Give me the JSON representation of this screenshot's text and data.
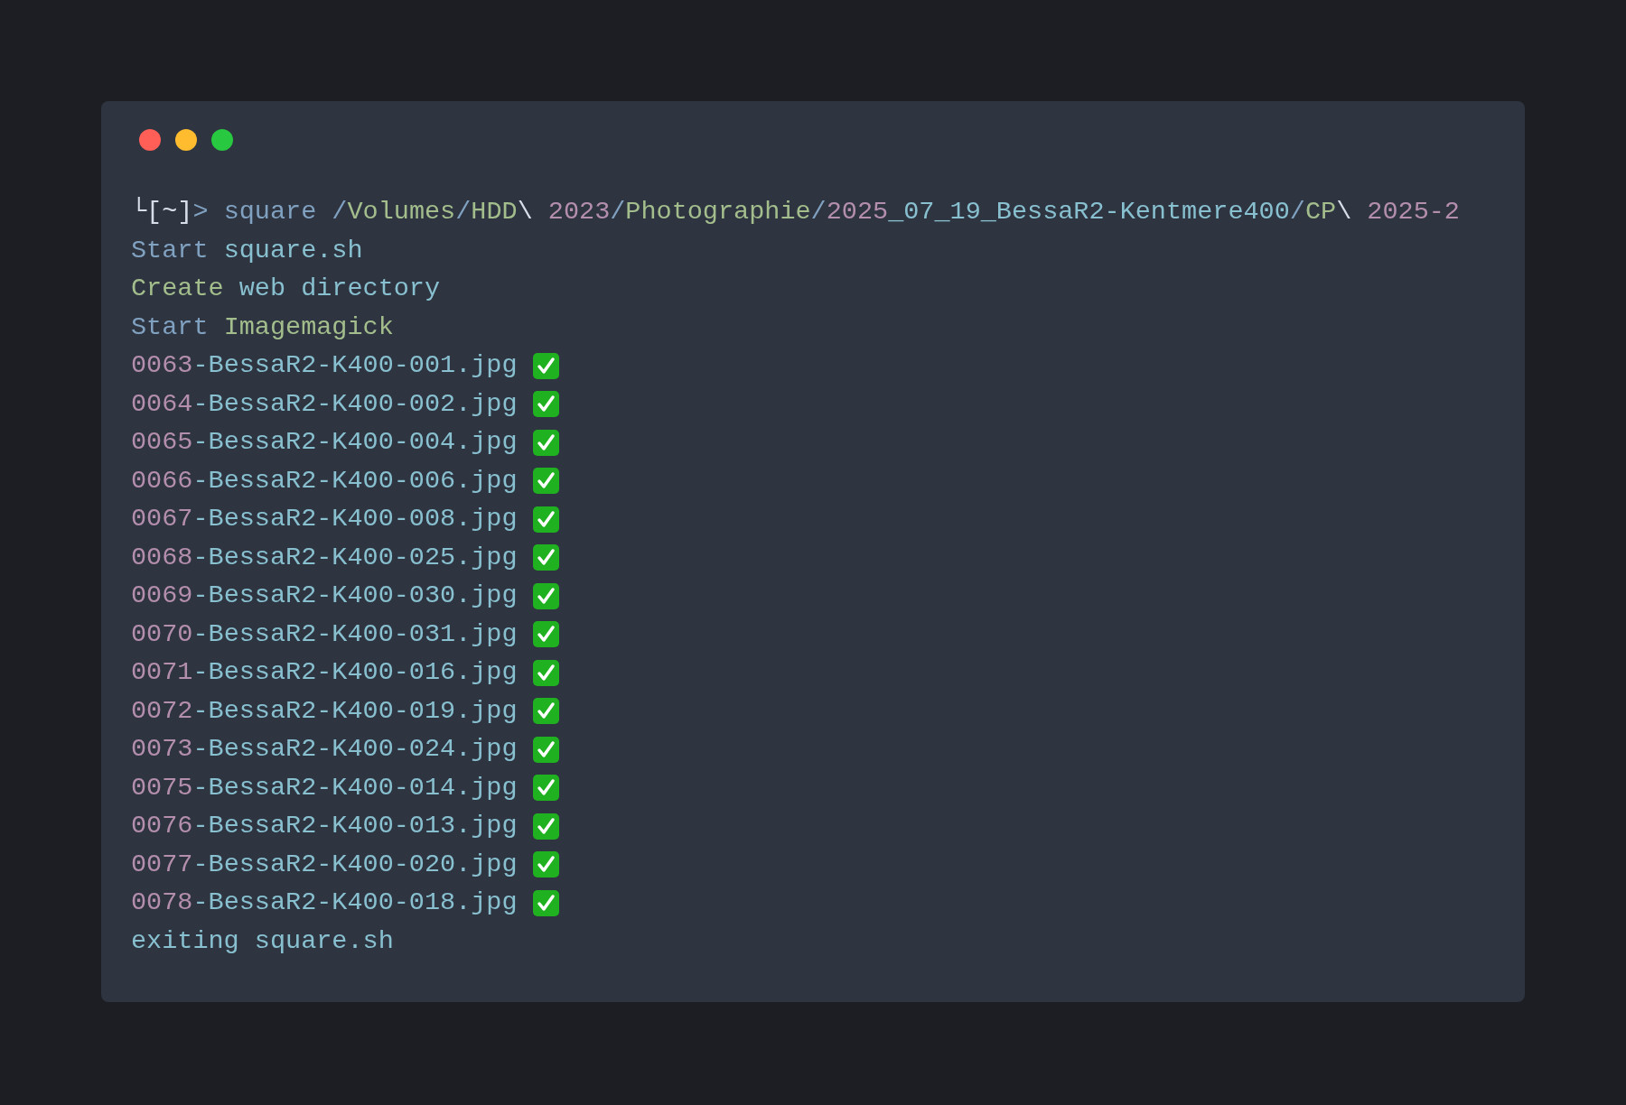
{
  "window": {
    "controls": [
      {
        "color": "#ff5f57"
      },
      {
        "color": "#febc2e"
      },
      {
        "color": "#28c840"
      }
    ]
  },
  "lines": [
    {
      "segments": [
        {
          "text": "└[~]",
          "color": "#d8dee9"
        },
        {
          "text": "> square ",
          "color": "#81a1c1"
        },
        {
          "text": "/",
          "color": "#81a1c1"
        },
        {
          "text": "Volumes",
          "color": "#a3be8c"
        },
        {
          "text": "/",
          "color": "#81a1c1"
        },
        {
          "text": "HDD",
          "color": "#a3be8c"
        },
        {
          "text": "\\",
          "color": "#d8dee9"
        },
        {
          "text": " 2023",
          "color": "#b48ead"
        },
        {
          "text": "/",
          "color": "#81a1c1"
        },
        {
          "text": "Photographie",
          "color": "#a3be8c"
        },
        {
          "text": "/",
          "color": "#81a1c1"
        },
        {
          "text": "2025",
          "color": "#b48ead"
        },
        {
          "text": "_07_19_BessaR2-Kentmere400",
          "color": "#88c0d0"
        },
        {
          "text": "/",
          "color": "#81a1c1"
        },
        {
          "text": "CP",
          "color": "#a3be8c"
        },
        {
          "text": "\\",
          "color": "#d8dee9"
        },
        {
          "text": " 2025-2",
          "color": "#b48ead"
        }
      ],
      "done": false
    },
    {
      "segments": [
        {
          "text": "Start ",
          "color": "#81a1c1"
        },
        {
          "text": "square.sh",
          "color": "#88c0d0"
        }
      ],
      "done": false
    },
    {
      "segments": [
        {
          "text": "Create ",
          "color": "#a3be8c"
        },
        {
          "text": "web directory",
          "color": "#88c0d0"
        }
      ],
      "done": false
    },
    {
      "segments": [
        {
          "text": "Start ",
          "color": "#81a1c1"
        },
        {
          "text": "Imagemagick",
          "color": "#a3be8c"
        }
      ],
      "done": false
    },
    {
      "segments": [
        {
          "text": "0063",
          "color": "#b48ead"
        },
        {
          "text": "-BessaR2-K400-001.jpg",
          "color": "#88c0d0"
        }
      ],
      "done": true
    },
    {
      "segments": [
        {
          "text": "0064",
          "color": "#b48ead"
        },
        {
          "text": "-BessaR2-K400-002.jpg",
          "color": "#88c0d0"
        }
      ],
      "done": true
    },
    {
      "segments": [
        {
          "text": "0065",
          "color": "#b48ead"
        },
        {
          "text": "-BessaR2-K400-004.jpg",
          "color": "#88c0d0"
        }
      ],
      "done": true
    },
    {
      "segments": [
        {
          "text": "0066",
          "color": "#b48ead"
        },
        {
          "text": "-BessaR2-K400-006.jpg",
          "color": "#88c0d0"
        }
      ],
      "done": true
    },
    {
      "segments": [
        {
          "text": "0067",
          "color": "#b48ead"
        },
        {
          "text": "-BessaR2-K400-008.jpg",
          "color": "#88c0d0"
        }
      ],
      "done": true
    },
    {
      "segments": [
        {
          "text": "0068",
          "color": "#b48ead"
        },
        {
          "text": "-BessaR2-K400-025.jpg",
          "color": "#88c0d0"
        }
      ],
      "done": true
    },
    {
      "segments": [
        {
          "text": "0069",
          "color": "#b48ead"
        },
        {
          "text": "-BessaR2-K400-030.jpg",
          "color": "#88c0d0"
        }
      ],
      "done": true
    },
    {
      "segments": [
        {
          "text": "0070",
          "color": "#b48ead"
        },
        {
          "text": "-BessaR2-K400-031.jpg",
          "color": "#88c0d0"
        }
      ],
      "done": true
    },
    {
      "segments": [
        {
          "text": "0071",
          "color": "#b48ead"
        },
        {
          "text": "-BessaR2-K400-016.jpg",
          "color": "#88c0d0"
        }
      ],
      "done": true
    },
    {
      "segments": [
        {
          "text": "0072",
          "color": "#b48ead"
        },
        {
          "text": "-BessaR2-K400-019.jpg",
          "color": "#88c0d0"
        }
      ],
      "done": true
    },
    {
      "segments": [
        {
          "text": "0073",
          "color": "#b48ead"
        },
        {
          "text": "-BessaR2-K400-024.jpg",
          "color": "#88c0d0"
        }
      ],
      "done": true
    },
    {
      "segments": [
        {
          "text": "0075",
          "color": "#b48ead"
        },
        {
          "text": "-BessaR2-K400-014.jpg",
          "color": "#88c0d0"
        }
      ],
      "done": true
    },
    {
      "segments": [
        {
          "text": "0076",
          "color": "#b48ead"
        },
        {
          "text": "-BessaR2-K400-013.jpg",
          "color": "#88c0d0"
        }
      ],
      "done": true
    },
    {
      "segments": [
        {
          "text": "0077",
          "color": "#b48ead"
        },
        {
          "text": "-BessaR2-K400-020.jpg",
          "color": "#88c0d0"
        }
      ],
      "done": true
    },
    {
      "segments": [
        {
          "text": "0078",
          "color": "#b48ead"
        },
        {
          "text": "-BessaR2-K400-018.jpg",
          "color": "#88c0d0"
        }
      ],
      "done": true
    },
    {
      "segments": [
        {
          "text": "exiting square.sh",
          "color": "#88c0d0"
        }
      ],
      "done": false
    }
  ]
}
